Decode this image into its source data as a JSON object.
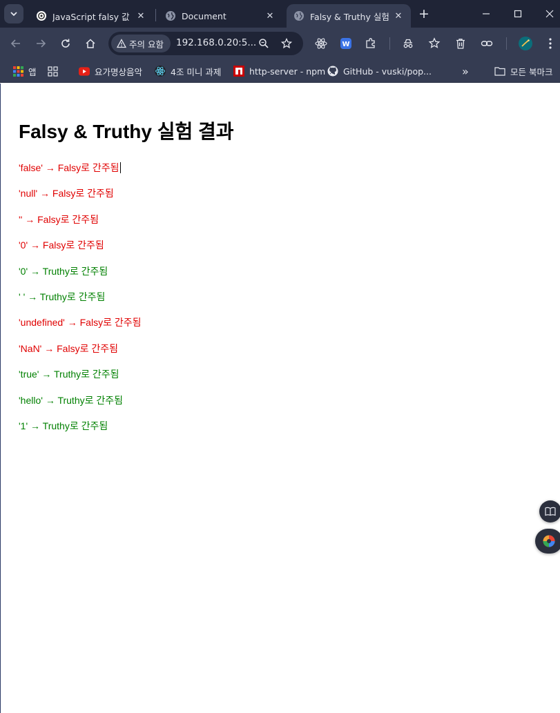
{
  "browser": {
    "tabs": [
      {
        "title": "JavaScript falsy 값 설",
        "active": false,
        "favicon": "openai-icon"
      },
      {
        "title": "Document",
        "active": false,
        "favicon": "globe-icon"
      },
      {
        "title": "Falsy & Truthy 실험",
        "active": true,
        "favicon": "globe-icon"
      }
    ],
    "address": {
      "security_label": "주의 요함",
      "url": "192.168.0.20:5..."
    },
    "bookmarks": [
      {
        "label": "앱",
        "icon": "apps-grid-icon"
      },
      {
        "label": "",
        "icon": "tab-groups-icon"
      },
      {
        "label": "요가명상음악",
        "icon": "youtube-icon"
      },
      {
        "label": "4조 미니 과제",
        "icon": "react-icon"
      },
      {
        "label": "http-server - npm",
        "icon": "npm-icon"
      },
      {
        "label": "GitHub - vuski/pop...",
        "icon": "github-icon"
      }
    ],
    "all_bookmarks_label": "모든 북마크",
    "overflow_label": "»"
  },
  "page": {
    "title": "Falsy & Truthy 실험 결과",
    "results": [
      {
        "text": "'false' → Falsy로 간주됨",
        "kind": "falsy"
      },
      {
        "text": "'null' → Falsy로 간주됨",
        "kind": "falsy"
      },
      {
        "text": "'' → Falsy로 간주됨",
        "kind": "falsy"
      },
      {
        "text": "'0' → Falsy로 간주됨",
        "kind": "falsy"
      },
      {
        "text": "'0' → Truthy로 간주됨",
        "kind": "truthy"
      },
      {
        "text": "' ' → Truthy로 간주됨",
        "kind": "truthy"
      },
      {
        "text": "'undefined' → Falsy로 간주됨",
        "kind": "falsy"
      },
      {
        "text": "'NaN' → Falsy로 간주됨",
        "kind": "falsy"
      },
      {
        "text": "'true' → Truthy로 간주됨",
        "kind": "truthy"
      },
      {
        "text": "'hello' → Truthy로 간주됨",
        "kind": "truthy"
      },
      {
        "text": "'1' → Truthy로 간주됨",
        "kind": "truthy"
      }
    ]
  },
  "colors": {
    "falsy": "#e00000",
    "truthy": "#008000",
    "chrome_dark": "#1f2436",
    "chrome_toolbar": "#353c52"
  }
}
